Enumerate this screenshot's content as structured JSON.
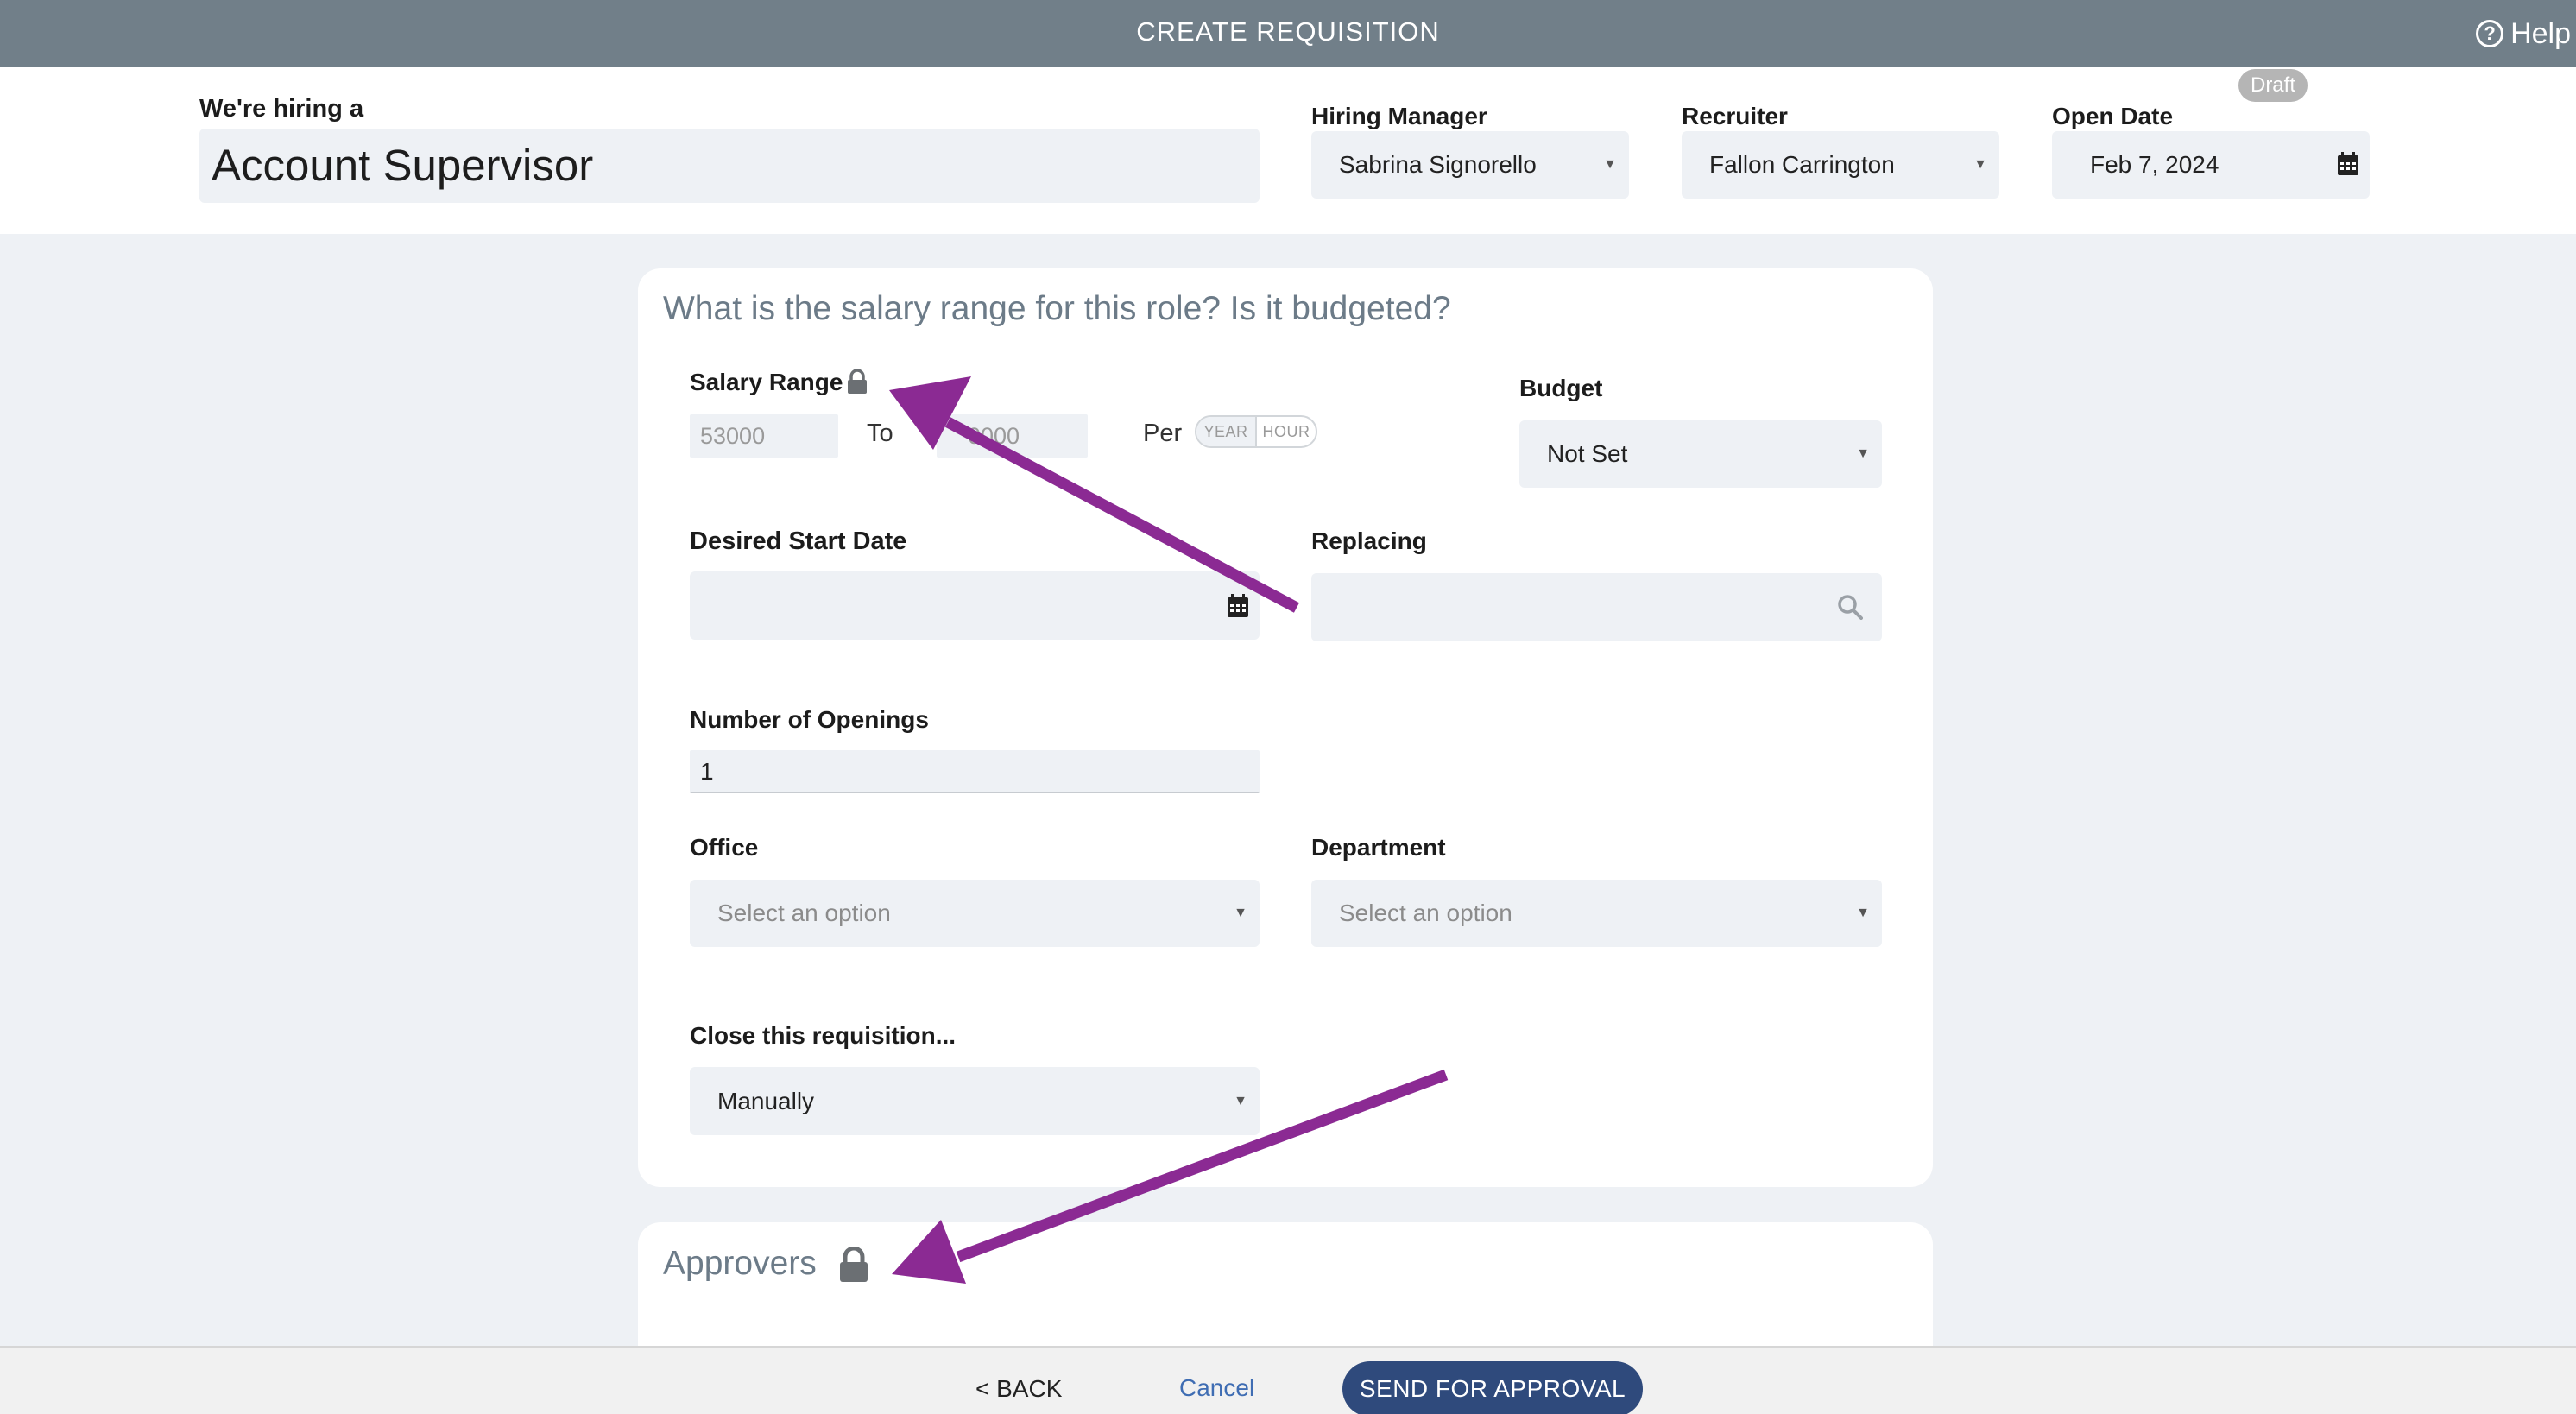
{
  "topbar": {
    "title": "CREATE REQUISITION",
    "help_label": "Help"
  },
  "header": {
    "hiring_label": "We're hiring a",
    "job_title": "Account Supervisor",
    "hiring_manager": {
      "label": "Hiring Manager",
      "value": "Sabrina Signorello"
    },
    "recruiter": {
      "label": "Recruiter",
      "value": "Fallon Carrington"
    },
    "open_date": {
      "label": "Open Date",
      "value": "Feb 7, 2024"
    },
    "status_badge": "Draft"
  },
  "salary_card": {
    "question": "What is the salary range for this role? Is it budgeted?",
    "salary_range": {
      "label": "Salary Range",
      "from": "53000",
      "to_label": "To",
      "to_value_visible": "0000",
      "per_label": "Per",
      "period_options": [
        "YEAR",
        "HOUR"
      ]
    },
    "budget": {
      "label": "Budget",
      "value": "Not Set"
    },
    "desired_start_date": {
      "label": "Desired Start Date",
      "value": ""
    },
    "replacing": {
      "label": "Replacing",
      "value": ""
    },
    "openings": {
      "label": "Number of Openings",
      "value": "1"
    },
    "office": {
      "label": "Office",
      "placeholder": "Select an option"
    },
    "department": {
      "label": "Department",
      "placeholder": "Select an option"
    },
    "close": {
      "label": "Close this requisition...",
      "value": "Manually"
    }
  },
  "approvers_card": {
    "title": "Approvers"
  },
  "footer": {
    "back_label": "< BACK",
    "cancel_label": "Cancel",
    "send_label": "SEND FOR APPROVAL"
  },
  "colors": {
    "topbar": "#717f89",
    "field_bg": "#eef1f5",
    "primary_button": "#2f4a7c",
    "arrow": "#8b2a93",
    "link": "#3f6db3"
  },
  "icons": [
    "help-circle-icon",
    "calendar-icon",
    "lock-icon",
    "search-icon",
    "chevron-down-icon",
    "annotation-arrow"
  ]
}
